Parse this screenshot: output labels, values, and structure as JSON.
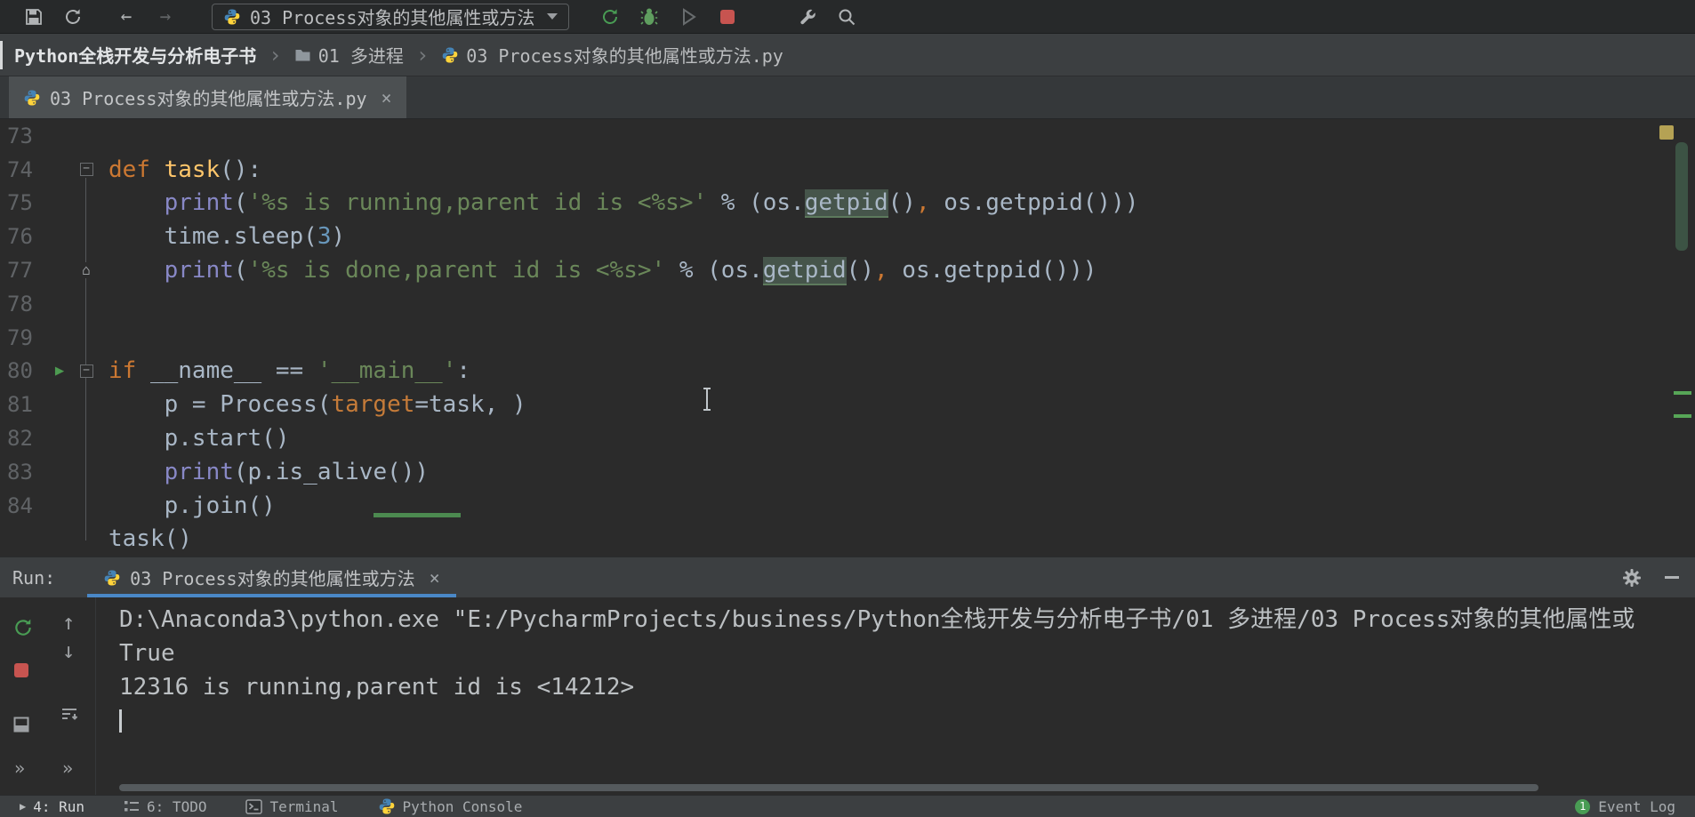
{
  "toolbar": {
    "run_config_label": "03 Process对象的其他属性或方法"
  },
  "breadcrumbs": {
    "root": "Python全栈开发与分析电子书",
    "folder": "01 多进程",
    "file": "03 Process对象的其他属性或方法.py"
  },
  "editor_tab": {
    "title": "03 Process对象的其他属性或方法.py"
  },
  "glyphs": {
    "back": "←",
    "forward": "→",
    "close": "×",
    "separator": "›",
    "up": "↑",
    "down": "↓",
    "expand": "»",
    "run_arrow": "▶",
    "fold_minus": "−",
    "fold_end": "⌂",
    "status_run": "▶"
  },
  "editor": {
    "lines": [
      {
        "no": "73",
        "segs": []
      },
      {
        "no": "74",
        "fold": "minus",
        "segs": [
          [
            "kw",
            "def"
          ],
          [
            "pl",
            " "
          ],
          [
            "fn",
            "task"
          ],
          [
            "pl",
            "():"
          ]
        ]
      },
      {
        "no": "75",
        "segs": [
          [
            "pl",
            "    "
          ],
          [
            "bi",
            "print"
          ],
          [
            "pl",
            "("
          ],
          [
            "str",
            "'%s is running,parent id is <%s>'"
          ],
          [
            "pl",
            " % (os."
          ],
          [
            "hl",
            "getpid"
          ],
          [
            "pl",
            "()"
          ],
          [
            "kw",
            ","
          ],
          [
            "pl",
            " os.getppid()))"
          ]
        ]
      },
      {
        "no": "76",
        "segs": [
          [
            "pl",
            "    time.sleep("
          ],
          [
            "num",
            "3"
          ],
          [
            "pl",
            ")"
          ]
        ]
      },
      {
        "no": "77",
        "fold": "end",
        "segs": [
          [
            "pl",
            "    "
          ],
          [
            "bi",
            "print"
          ],
          [
            "pl",
            "("
          ],
          [
            "str",
            "'%s is done,parent id is <%s>'"
          ],
          [
            "pl",
            " % (os."
          ],
          [
            "hl",
            "getpid"
          ],
          [
            "pl",
            "()"
          ],
          [
            "kw",
            ","
          ],
          [
            "pl",
            " os.getppid()))"
          ]
        ]
      },
      {
        "no": "78",
        "segs": []
      },
      {
        "no": "79",
        "segs": []
      },
      {
        "no": "80",
        "run": true,
        "fold": "minus",
        "segs": [
          [
            "kw",
            "if"
          ],
          [
            "pl",
            " __name__ == "
          ],
          [
            "str",
            "'__main__'"
          ],
          [
            "pl",
            ":"
          ]
        ]
      },
      {
        "no": "81",
        "segs": [
          [
            "pl",
            "    p = Process("
          ],
          [
            "kwarg",
            "target"
          ],
          [
            "pl",
            "=task, )"
          ]
        ]
      },
      {
        "no": "82",
        "segs": [
          [
            "pl",
            "    p.start()"
          ]
        ]
      },
      {
        "no": "83",
        "segs": [
          [
            "pl",
            "    "
          ],
          [
            "bi",
            "print"
          ],
          [
            "pl",
            "(p.is_alive())"
          ]
        ]
      },
      {
        "no": "84",
        "segs": [
          [
            "pl",
            "    p.join()"
          ]
        ]
      },
      {
        "no": "",
        "segs": [
          [
            "pl",
            "task()"
          ]
        ]
      }
    ]
  },
  "run_panel": {
    "label": "Run:",
    "tab_title": "03 Process对象的其他属性或方法",
    "console": [
      "D:\\Anaconda3\\python.exe \"E:/PycharmProjects/business/Python全栈开发与分析电子书/01 多进程/03 Process对象的其他属性或",
      "True",
      "12316 is running,parent id is <14212>"
    ]
  },
  "status_bar": {
    "run": "4: Run",
    "todo": "6: TODO",
    "terminal": "Terminal",
    "python_console": "Python Console",
    "event_log": "Event Log",
    "event_log_badge": "1"
  },
  "colors": {
    "keyword": "#cc7832",
    "string": "#6a8759",
    "number": "#6897bb",
    "builtin": "#8888c6",
    "function": "#ffc66b",
    "run_green": "#499c54",
    "stop_red": "#c75450",
    "tab_underline": "#4a88c7"
  }
}
